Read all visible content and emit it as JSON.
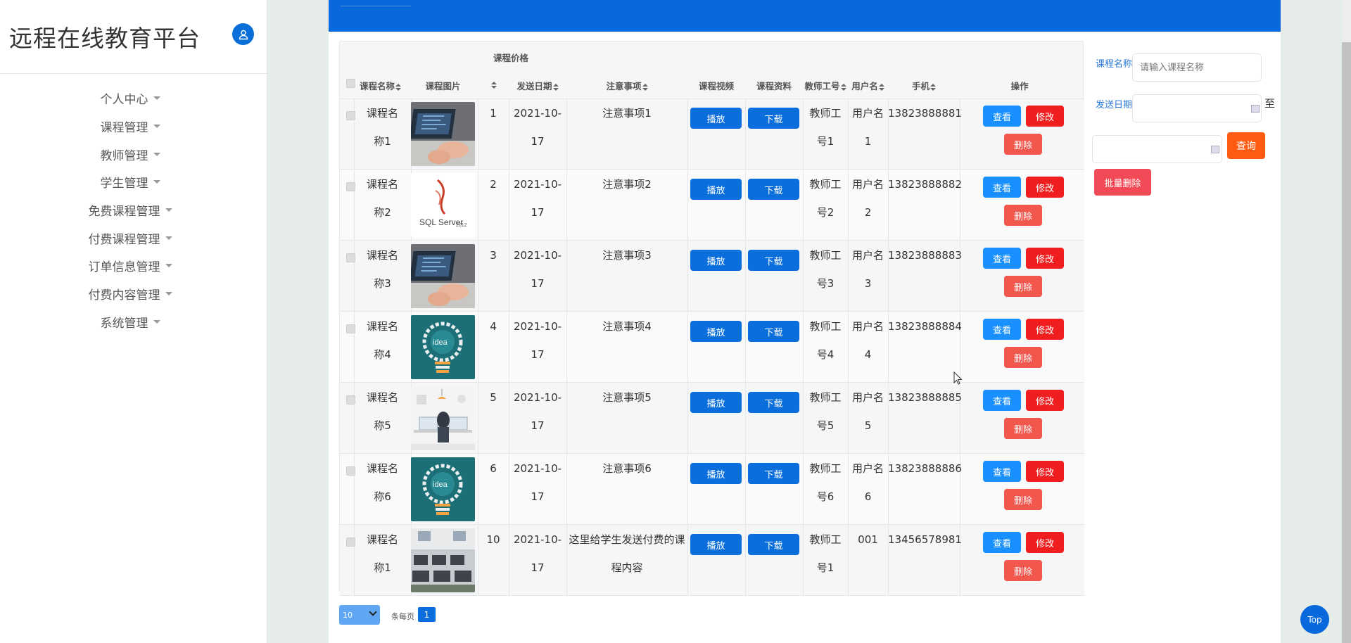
{
  "app": {
    "title": "远程在线教育平台"
  },
  "sidebar": {
    "items": [
      {
        "label": "个人中心"
      },
      {
        "label": "课程管理"
      },
      {
        "label": "教师管理"
      },
      {
        "label": "学生管理"
      },
      {
        "label": "免费课程管理"
      },
      {
        "label": "付费课程管理"
      },
      {
        "label": "订单信息管理"
      },
      {
        "label": "付费内容管理"
      },
      {
        "label": "系统管理"
      }
    ]
  },
  "table": {
    "headers": {
      "name": "课程名称",
      "image": "课程图片",
      "price": "课程价格",
      "date": "发送日期",
      "notes": "注意事项",
      "video": "课程视频",
      "material": "课程资料",
      "teacher_id": "教师工号",
      "username": "用户名",
      "phone": "手机",
      "actions": "操作"
    },
    "rows": [
      {
        "name_a": "课程名",
        "name_b": "称1",
        "image": "laptop-photo",
        "price": "1",
        "date_a": "2021-10-",
        "date_b": "17",
        "notes_a": "注意事项1",
        "notes_b": "",
        "teacher_a": "教师工",
        "teacher_b": "号1",
        "user_a": "用户名",
        "user_b": "1",
        "phone": "13823888881"
      },
      {
        "name_a": "课程名",
        "name_b": "称2",
        "image": "sql-server-logo",
        "price": "2",
        "date_a": "2021-10-",
        "date_b": "17",
        "notes_a": "注意事项2",
        "notes_b": "",
        "teacher_a": "教师工",
        "teacher_b": "号2",
        "user_a": "用户名",
        "user_b": "2",
        "phone": "13823888882"
      },
      {
        "name_a": "课程名",
        "name_b": "称3",
        "image": "laptop-photo",
        "price": "3",
        "date_a": "2021-10-",
        "date_b": "17",
        "notes_a": "注意事项3",
        "notes_b": "",
        "teacher_a": "教师工",
        "teacher_b": "号3",
        "user_a": "用户名",
        "user_b": "3",
        "phone": "13823888883"
      },
      {
        "name_a": "课程名",
        "name_b": "称4",
        "image": "idea-bulb",
        "price": "4",
        "date_a": "2021-10-",
        "date_b": "17",
        "notes_a": "注意事项4",
        "notes_b": "",
        "teacher_a": "教师工",
        "teacher_b": "号4",
        "user_a": "用户名",
        "user_b": "4",
        "phone": "13823888884"
      },
      {
        "name_a": "课程名",
        "name_b": "称5",
        "image": "desk-illustration",
        "price": "5",
        "date_a": "2021-10-",
        "date_b": "17",
        "notes_a": "注意事项5",
        "notes_b": "",
        "teacher_a": "教师工",
        "teacher_b": "号5",
        "user_a": "用户名",
        "user_b": "5",
        "phone": "13823888885"
      },
      {
        "name_a": "课程名",
        "name_b": "称6",
        "image": "idea-bulb",
        "price": "6",
        "date_a": "2021-10-",
        "date_b": "17",
        "notes_a": "注意事项6",
        "notes_b": "",
        "teacher_a": "教师工",
        "teacher_b": "号6",
        "user_a": "用户名",
        "user_b": "6",
        "phone": "13823888886"
      },
      {
        "name_a": "课程名",
        "name_b": "称1",
        "image": "classroom-photo",
        "price": "10",
        "date_a": "2021-10-",
        "date_b": "17",
        "notes_a": "这里给学生发送付费的课",
        "notes_b": "程内容",
        "teacher_a": "教师工",
        "teacher_b": "号1",
        "user_a": "001",
        "user_b": "",
        "phone": "13456578981"
      }
    ],
    "buttons": {
      "play": "播放",
      "download": "下载",
      "view": "查看",
      "edit": "修改",
      "delete": "删除"
    }
  },
  "pagination": {
    "page_size": "10",
    "per_page_label": "条每页",
    "current_page": "1"
  },
  "search": {
    "name_label": "课程名称",
    "name_placeholder": "请输入课程名称",
    "date_label": "发送日期",
    "to_label": "至",
    "query_button": "查询",
    "batch_delete_button": "批量删除"
  },
  "top_button": "Top",
  "colors": {
    "brand_blue": "#0868dc",
    "danger": "#f01e1e",
    "query": "#ff5a12"
  }
}
